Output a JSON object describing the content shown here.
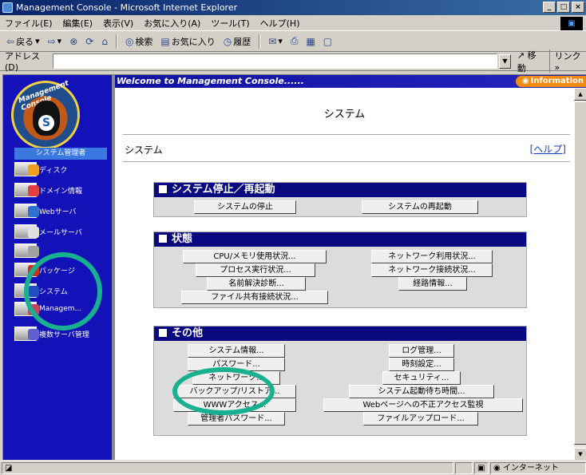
{
  "window": {
    "title": "Management Console - Microsoft Internet Explorer",
    "controls": [
      "_",
      "□",
      "×"
    ]
  },
  "menu": [
    "ファイル(E)",
    "編集(E)",
    "表示(V)",
    "お気に入り(A)",
    "ツール(T)",
    "ヘルプ(H)"
  ],
  "toolbar": {
    "back": "戻る",
    "search": "検索",
    "favorites": "お気に入り",
    "history": "履歴"
  },
  "address": {
    "label": "アドレス(D)",
    "value": "",
    "go": "移動",
    "links": "リンク »"
  },
  "sidebar": {
    "logo_text": "Management Console",
    "admin_label": "システム管理者",
    "items": [
      {
        "label": "ディスク",
        "icon": "disk-icon",
        "color": "#f0a020"
      },
      {
        "label": "ドメイン情報",
        "icon": "domain-icon",
        "color": "#e04040"
      },
      {
        "label": "Webサーバ",
        "icon": "web-server-icon",
        "color": "#3070d0"
      },
      {
        "label": "メールサーバ",
        "icon": "mail-server-icon",
        "color": "#e0e0e0"
      },
      {
        "label": "",
        "icon": "unknown-icon",
        "color": "#a0a0a0"
      },
      {
        "label": "パッケージ",
        "icon": "package-icon",
        "color": "#d03020"
      },
      {
        "label": "システム",
        "icon": "system-icon",
        "color": "#2050c0"
      },
      {
        "label": "Managem...",
        "icon": "management-icon",
        "color": "#d04060"
      },
      {
        "label": "複数サーバ管理",
        "icon": "multi-server-icon",
        "color": "#6060d0"
      }
    ]
  },
  "welcome": "Welcome to Management Console......",
  "info_tab": "Information",
  "page_title": "システム",
  "breadcrumb": "システム",
  "help_link": "[ヘルプ]",
  "sections": [
    {
      "title": "システム停止／再起動",
      "buttons": [
        "システムの停止",
        "システムの再起動"
      ]
    },
    {
      "title": "状態",
      "buttons": [
        "CPU/メモリ使用状況...",
        "ネットワーク利用状況...",
        "プロセス実行状況...",
        "ネットワーク接続状況...",
        "名前解決診断...",
        "経路情報...",
        "ファイル共有接続状況..."
      ]
    },
    {
      "title": "その他",
      "buttons": [
        "システム情報...",
        "ログ管理...",
        "パスワード...",
        "時刻設定...",
        "ネットワーク...",
        "セキュリティ...",
        "バックアップ/リストア...",
        "システム起動待ち時間...",
        "WWWアクセス...",
        "Webページへの不正アクセス監視",
        "管理者パスワード...",
        "ファイルアップロード..."
      ]
    }
  ],
  "status": {
    "zone": "インターネット"
  },
  "colors": {
    "sidebar": "#1212b8",
    "section_header": "#0a0a80",
    "highlight": "#19b090",
    "info": "#f08a10"
  }
}
